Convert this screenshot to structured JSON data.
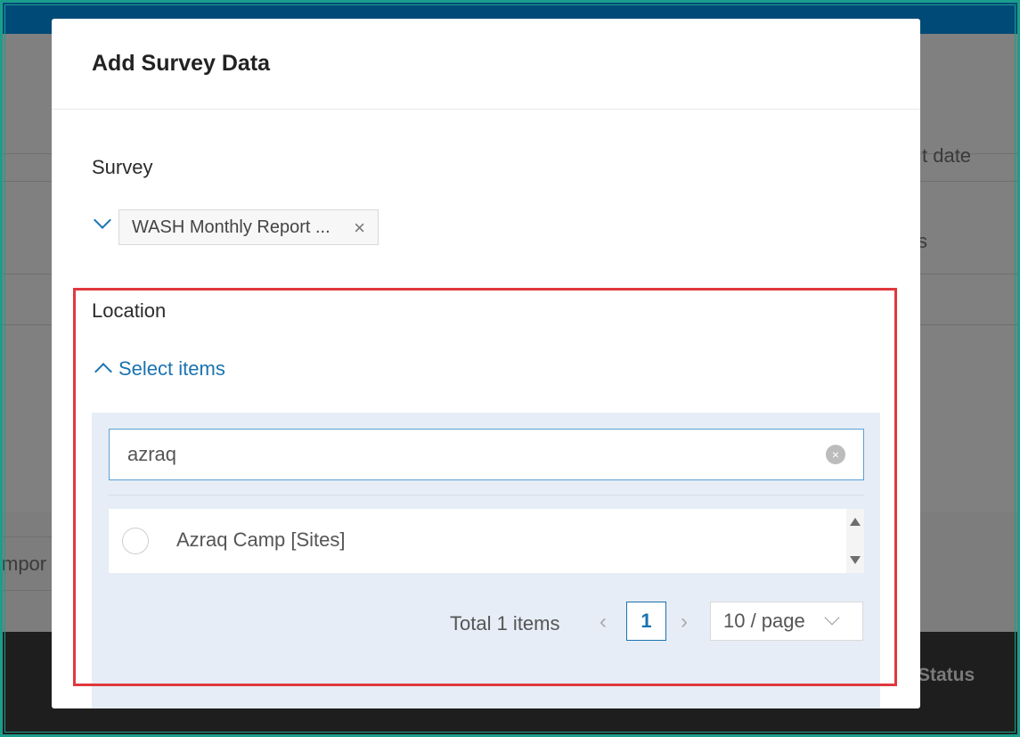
{
  "background": {
    "header_partial": "t date",
    "row_partial": "s",
    "left_partial": "mpor",
    "footer_status": "Status"
  },
  "modal": {
    "title": "Add Survey Data",
    "survey": {
      "label": "Survey",
      "selected_tag": "WASH Monthly Report ...",
      "tag_close_icon": "×"
    },
    "location": {
      "label": "Location",
      "select_link": "Select items",
      "search_value": "azraq",
      "clear_icon": "×",
      "items": [
        {
          "label": "Azraq Camp [Sites]",
          "checked": false
        }
      ],
      "pagination": {
        "total": "Total 1 items",
        "prev": "‹",
        "current_page": "1",
        "next": "›",
        "page_size": "10 / page"
      }
    }
  },
  "colors": {
    "link_blue": "#1a73b0",
    "highlight_red": "#e0383e",
    "frame_teal": "#1a9e8c",
    "panel_bg": "#e6edf6"
  }
}
